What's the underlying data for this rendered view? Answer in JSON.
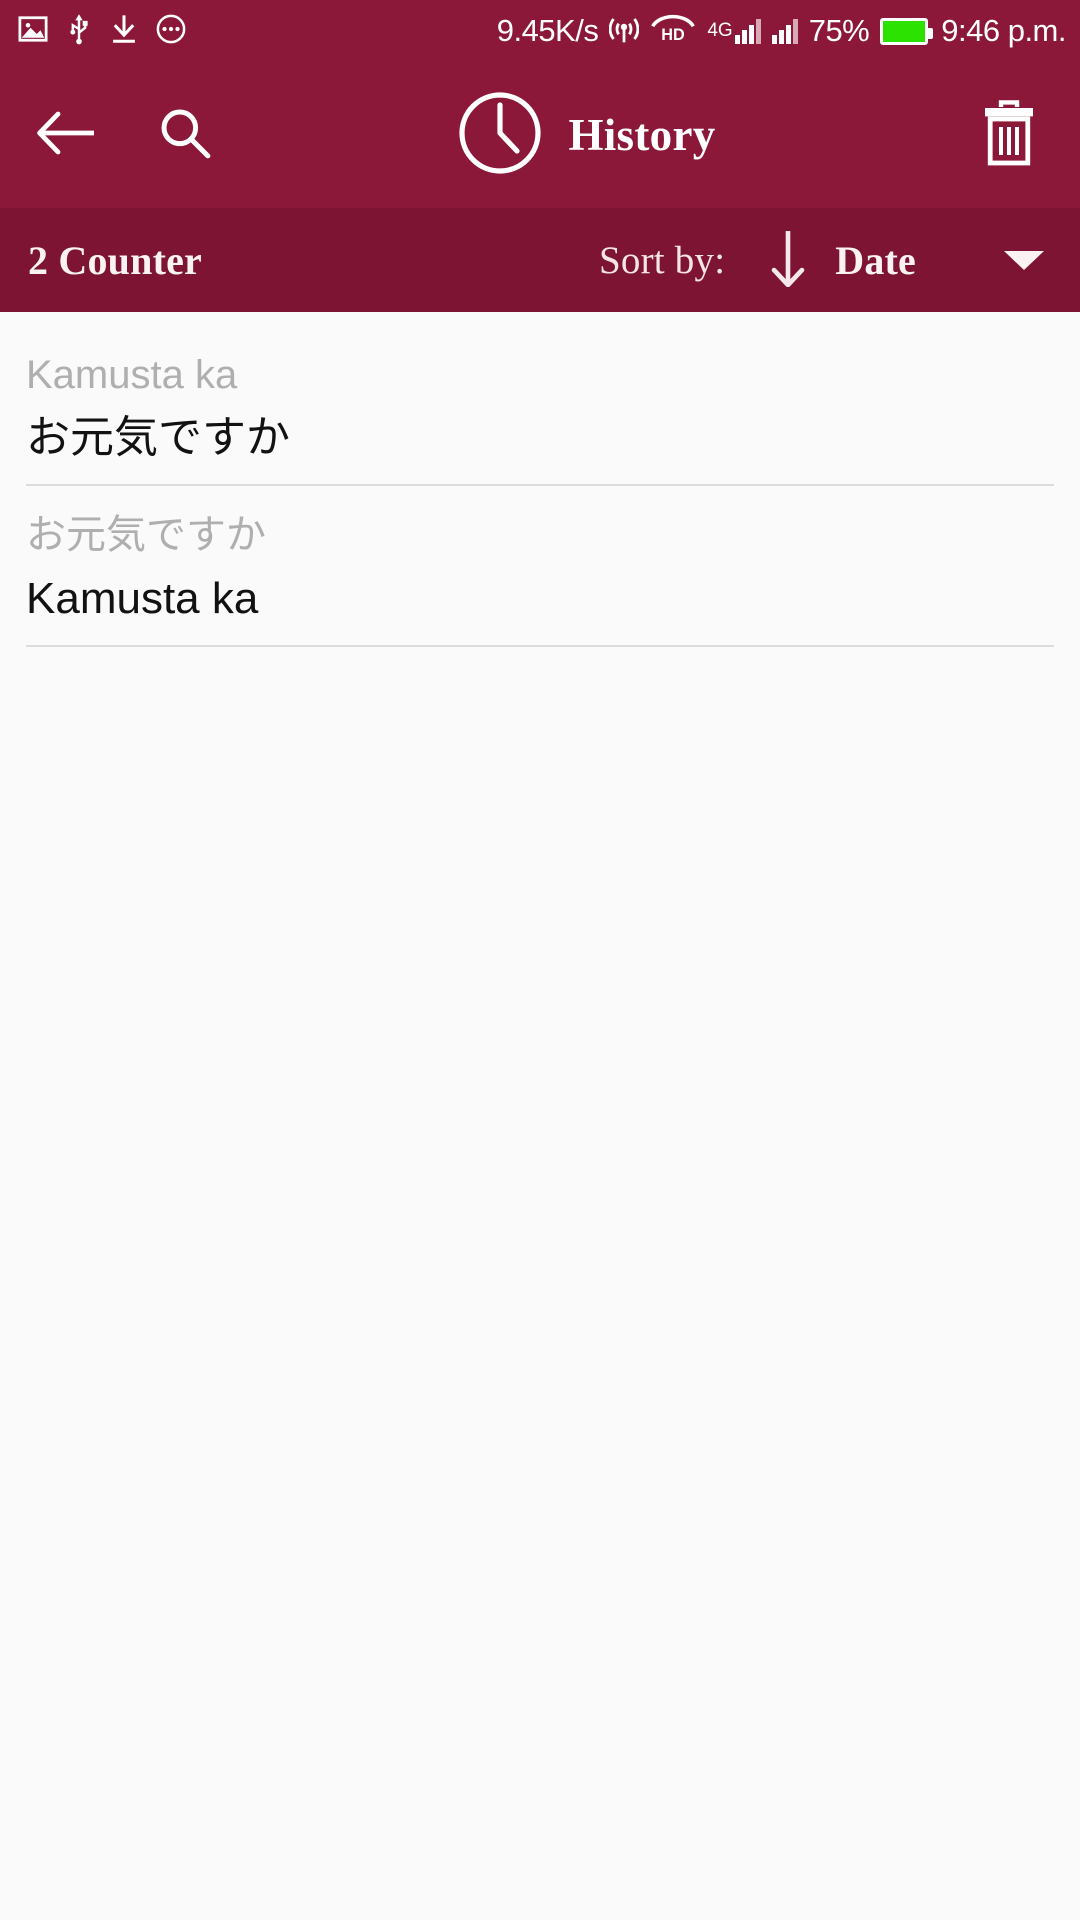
{
  "status_bar": {
    "left_icons": [
      "image-icon",
      "usb-icon",
      "download-icon",
      "more-options-icon"
    ],
    "network_speed": "9.45K/s",
    "hotspot_icon": "hotspot-icon",
    "hd_label": "HD",
    "network_type": "4G",
    "battery_percent": "75%",
    "time": "9:46 p.m.",
    "battery_color": "#2BE200"
  },
  "app_bar": {
    "title": "History",
    "back_icon": "back-arrow-icon",
    "search_icon": "search-icon",
    "clock_icon": "clock-icon",
    "delete_icon": "trash-icon",
    "background_color": "#8B1839"
  },
  "sort_bar": {
    "counter": "2 Counter",
    "sort_by_label": "Sort by:",
    "sort_direction_icon": "arrow-down-icon",
    "sort_value": "Date",
    "dropdown_icon": "chevron-down-icon",
    "background_color": "#7E1433"
  },
  "history": {
    "items": [
      {
        "source": "Kamusta ka",
        "target": "お元気ですか"
      },
      {
        "source": "お元気ですか",
        "target": "Kamusta ka"
      }
    ]
  }
}
